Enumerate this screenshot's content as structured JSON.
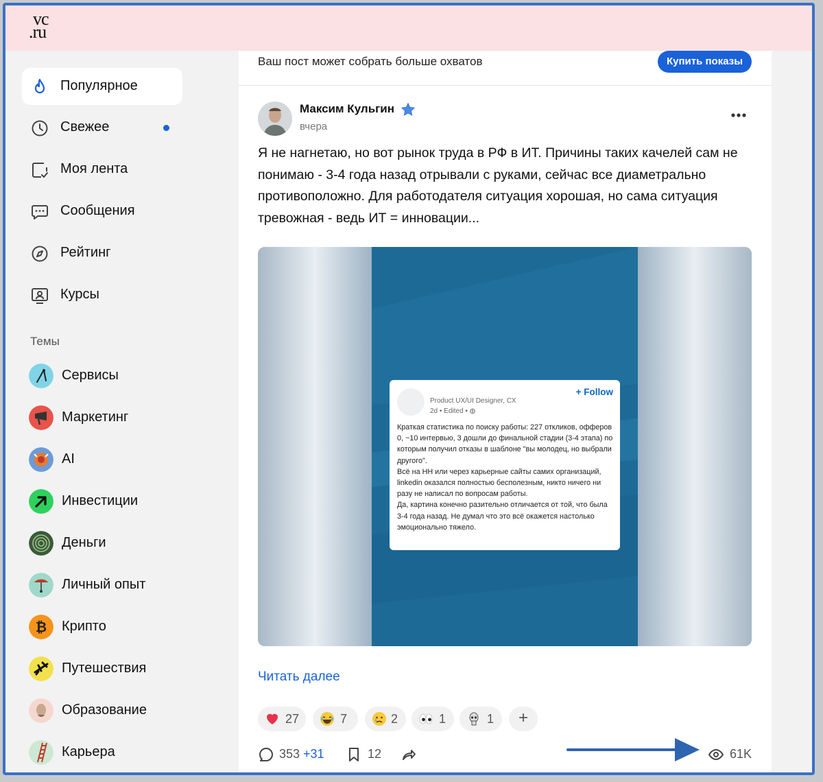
{
  "colors": {
    "accent": "#1a62d8",
    "topbar": "#fbe1e3",
    "frame_border": "#3b71c4",
    "annotation_arrow": "#2f64b0",
    "media_blue": "#1e6a96"
  },
  "logo": {
    "line1": "vc",
    "line2": ".ru"
  },
  "nav": {
    "items": [
      {
        "label": "Популярное",
        "icon": "flame-icon",
        "active": true
      },
      {
        "label": "Свежее",
        "icon": "clock-icon",
        "unread_dot": true
      },
      {
        "label": "Моя лента",
        "icon": "feed-check-icon"
      },
      {
        "label": "Сообщения",
        "icon": "chat-icon"
      },
      {
        "label": "Рейтинг",
        "icon": "compass-icon"
      },
      {
        "label": "Курсы",
        "icon": "courses-icon"
      }
    ]
  },
  "themes": {
    "title": "Темы",
    "items": [
      {
        "label": "Сервисы",
        "icon": "services-icon"
      },
      {
        "label": "Маркетинг",
        "icon": "marketing-icon"
      },
      {
        "label": "AI",
        "icon": "ai-icon"
      },
      {
        "label": "Инвестиции",
        "icon": "investments-icon"
      },
      {
        "label": "Деньги",
        "icon": "money-icon"
      },
      {
        "label": "Личный опыт",
        "icon": "personal-experience-icon"
      },
      {
        "label": "Крипто",
        "icon": "bitcoin-icon"
      },
      {
        "label": "Путешествия",
        "icon": "plane-icon"
      },
      {
        "label": "Образование",
        "icon": "education-icon"
      },
      {
        "label": "Карьера",
        "icon": "ladder-icon"
      }
    ]
  },
  "promo": {
    "text": "Ваш пост может собрать больше охватов",
    "button": "Купить показы"
  },
  "post": {
    "author": "Максим Кульгин",
    "time": "вчера",
    "text": "Я не нагнетаю, но вот рынок труда в РФ в ИТ. Причины таких качелей сам не понимаю - 3-4 года назад отрывали с руками, сейчас все диаметрально противоположно. Для работодателя ситуация хорошая, но сама ситуация тревожная - ведь ИТ = инновации...",
    "read_more": "Читать далее",
    "embedded": {
      "follow": "+ Follow",
      "role": "Product UX/UI Designer, CX",
      "meta": "2d • Edited •",
      "text": "Краткая статистика по поиску работы: 227 откликов, офферов 0, ~10 интервью, 3 дошли до финальной стадии (3-4 этапа) по которым получил отказы в шаблоне \"вы молодец, но выбрали другого\".\nВсё на НН или через карьерные сайты самих организаций, linkedin оказался полностью бесполезным, никто ничего ни разу не написал по вопросам работы.\n Да, картина конечно  разительно отличается от той, что была 3-4 года назад. Не думал что это всё окажется настолько эмоционально тяжело."
    },
    "reactions": [
      {
        "icon": "heart-icon",
        "count": "27"
      },
      {
        "icon": "laughing-emoji-icon",
        "count": "7"
      },
      {
        "icon": "sad-emoji-icon",
        "count": "2"
      },
      {
        "icon": "eyes-emoji-icon",
        "count": "1"
      },
      {
        "icon": "skull-emoji-icon",
        "count": "1"
      }
    ],
    "add_reaction": "+",
    "comments": "353",
    "comments_new": "+31",
    "bookmarks": "12",
    "views": "61K"
  }
}
